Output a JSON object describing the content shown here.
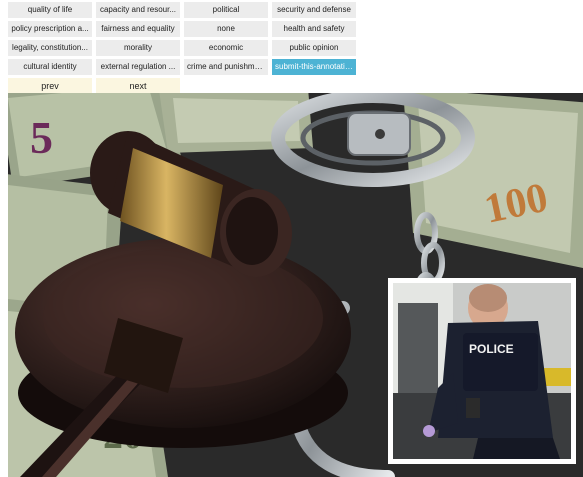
{
  "frames": [
    "quality of life",
    "capacity and resour...",
    "political",
    "security and defense",
    "policy prescription a...",
    "fairness and equality",
    "none",
    "health and safety",
    "legality, constitution...",
    "morality",
    "economic",
    "public opinion",
    "cultural identity",
    "external regulation ...",
    "crime and punishment"
  ],
  "submit_label": "submit-this-annotation",
  "prev_label": "prev",
  "next_label": "next",
  "image": {
    "inset_badge_text": "POLICE",
    "banknote_numerals": [
      "100",
      "20",
      "5"
    ],
    "colors": {
      "submit": "#4db3d4",
      "button": "#ececec",
      "nav_button": "#fbf6e0",
      "background": "#262626"
    }
  }
}
